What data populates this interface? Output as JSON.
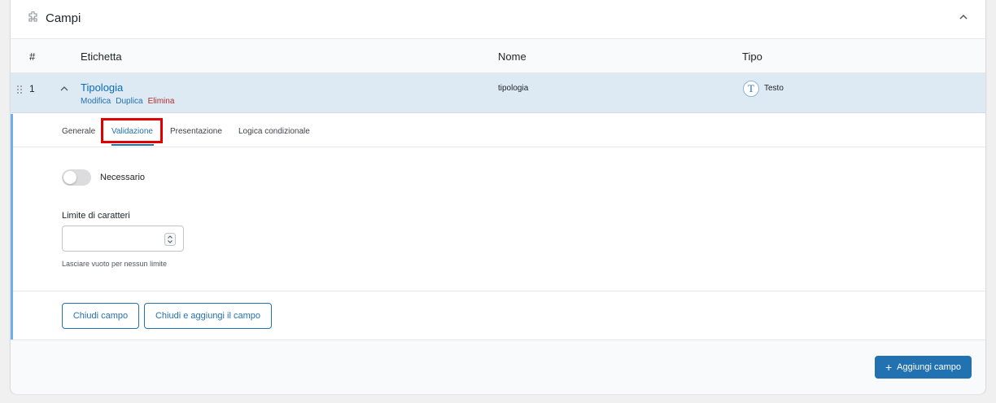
{
  "panel": {
    "title": "Campi"
  },
  "table": {
    "headers": {
      "num": "#",
      "label": "Etichetta",
      "name": "Nome",
      "type": "Tipo"
    }
  },
  "field": {
    "num": "1",
    "label": "Tipologia",
    "actions": {
      "edit": "Modifica",
      "duplicate": "Duplica",
      "delete": "Elimina"
    },
    "name": "tipologia",
    "type_icon": "T",
    "type": "Testo"
  },
  "tabs": [
    {
      "label": "Generale",
      "active": false
    },
    {
      "label": "Validazione",
      "active": true
    },
    {
      "label": "Presentazione",
      "active": false
    },
    {
      "label": "Logica condizionale",
      "active": false
    }
  ],
  "validation": {
    "required_label": "Necessario",
    "required_on": false,
    "char_limit_label": "Limite di caratteri",
    "char_limit_value": "",
    "char_limit_help": "Lasciare vuoto per nessun limite"
  },
  "buttons": {
    "close_field": "Chiudi campo",
    "close_and_add": "Chiudi e aggiungi il campo",
    "add_field": "Aggiungi campo"
  },
  "colors": {
    "accent": "#2271b1",
    "selected_row": "#dde9f3",
    "delete": "#b32d2e",
    "highlight": "#e00000"
  }
}
